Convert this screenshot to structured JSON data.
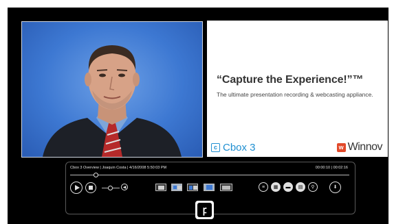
{
  "slide": {
    "title": "“Capture the Experience!”™",
    "subtitle": "The ultimate presentation recording & webcasting appliance.",
    "product_logo_mark": "c",
    "product_logo_text": "Cbox 3",
    "company_logo_mark": "w",
    "company_logo_text": "Winnov"
  },
  "player": {
    "info": "Cbox 3 Overview | Joaquin Costa | 4/16/2008 5:50:03 PM",
    "time": "00:00:10 | 00:02:16",
    "progress_fraction": 0.09,
    "volume_fraction": 0.45,
    "icons": {
      "play": "play-icon",
      "stop": "stop-icon",
      "volume": "speaker-icon",
      "index": "index-icon",
      "thumbnails": "grid-icon",
      "captions": "captions-icon",
      "notes": "document-icon",
      "search": "search-icon",
      "download": "download-icon"
    }
  },
  "colors": {
    "background": "#000000",
    "accent_blue": "#1f8fd1",
    "accent_red": "#e2492a",
    "video_blue": "#3d78d2"
  }
}
